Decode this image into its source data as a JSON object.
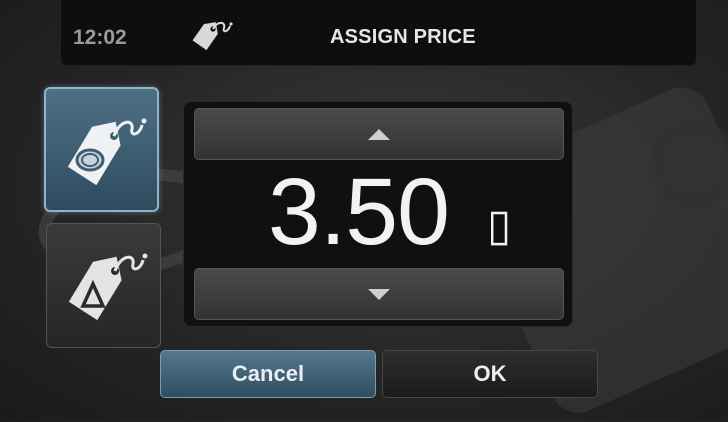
{
  "header": {
    "time": "12:02",
    "icon": "price-tag-icon",
    "title": "ASSIGN PRICE"
  },
  "side_buttons": [
    {
      "icon": "price-tag-coin-icon",
      "state": "selected"
    },
    {
      "icon": "price-tag-delta-icon",
      "state": "unselected"
    }
  ],
  "spinner": {
    "value": "3.50",
    "currency_symbol": "▯",
    "up_icon": "arrow-up-icon",
    "down_icon": "arrow-down-icon"
  },
  "actions": {
    "cancel_label": "Cancel",
    "ok_label": "OK"
  },
  "colors": {
    "accent": "#3f6176",
    "background": "#262626"
  }
}
